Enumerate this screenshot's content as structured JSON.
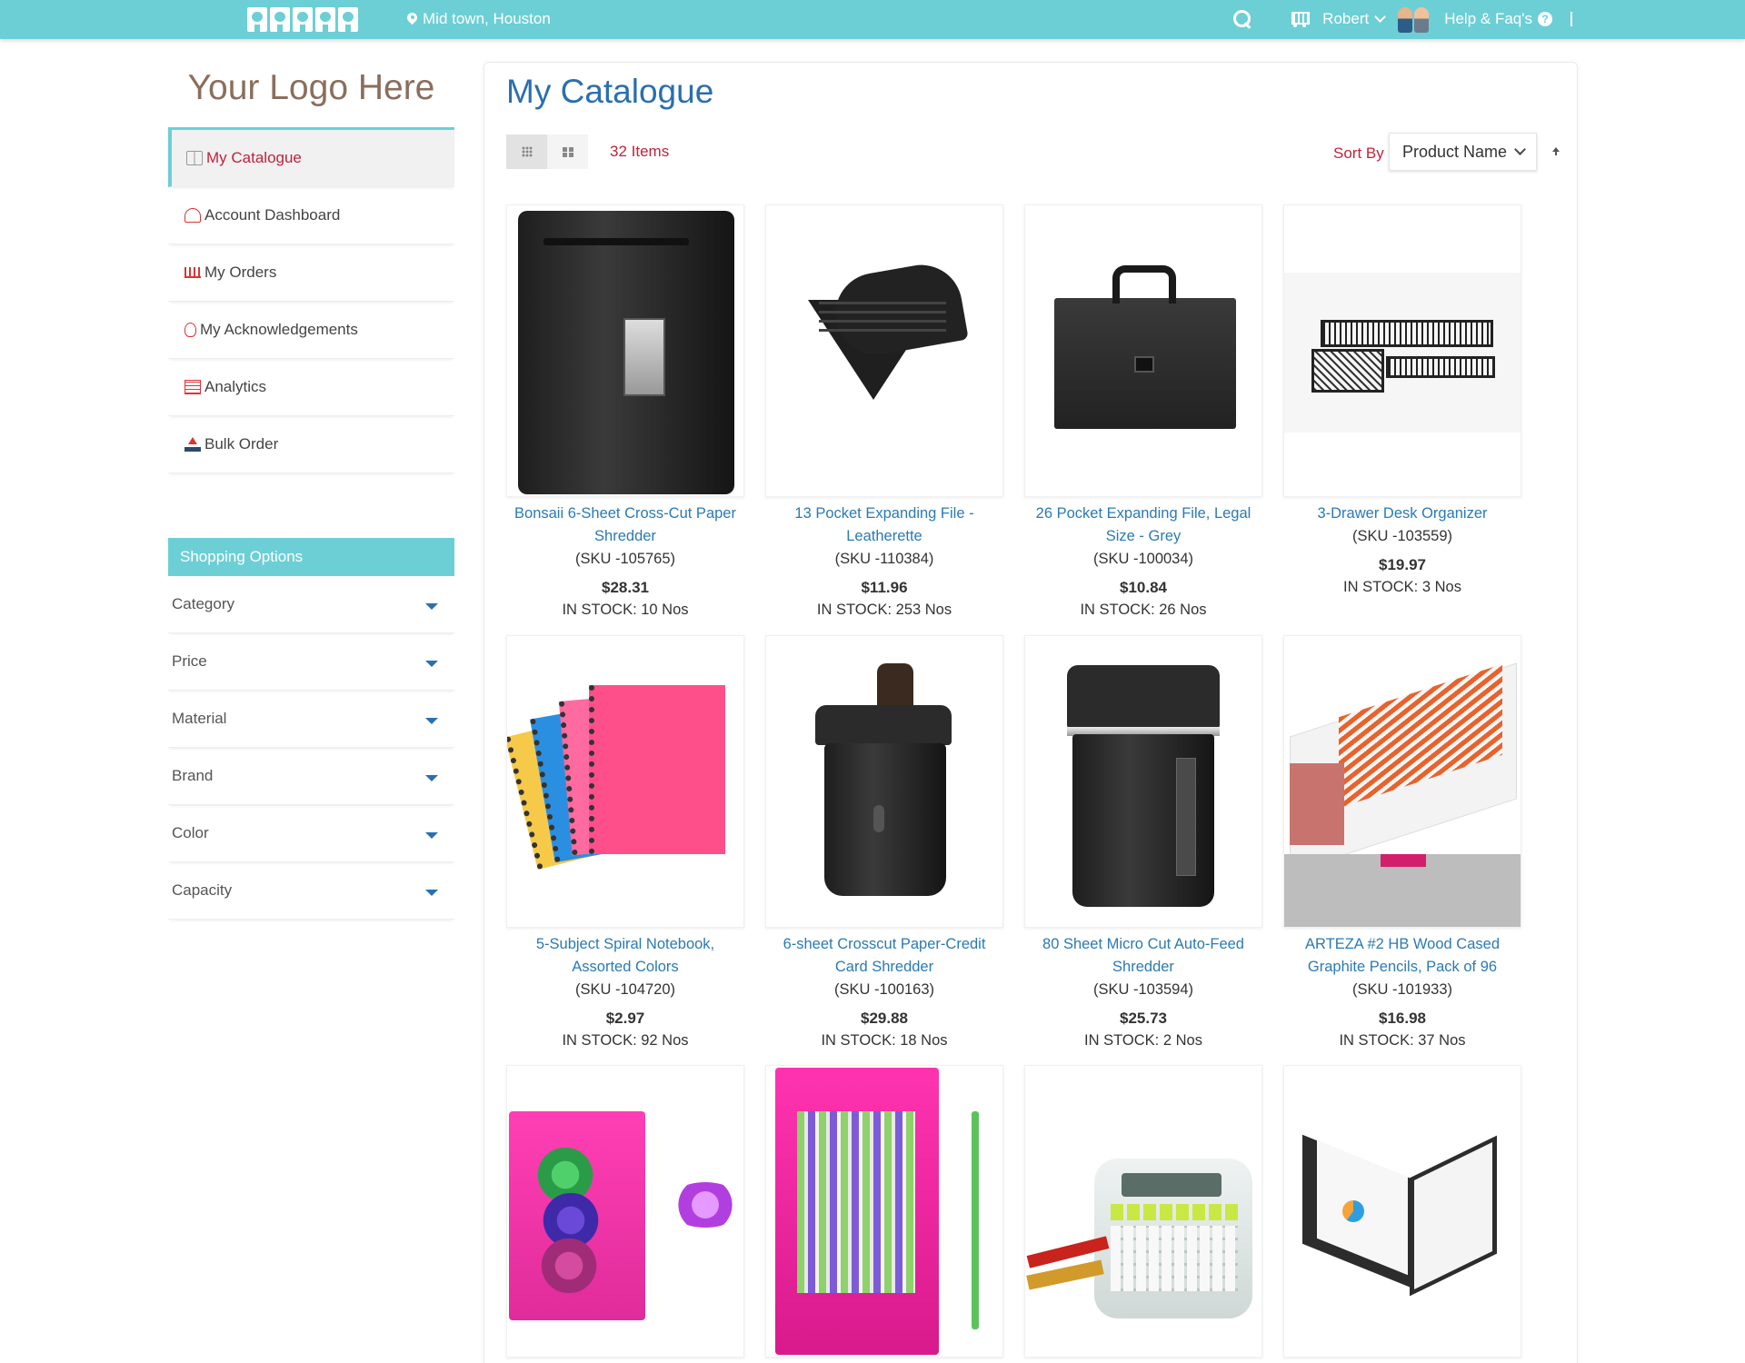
{
  "topbar": {
    "location": "Mid town, Houston",
    "user_name": "Robert",
    "help_label": "Help & Faq's",
    "help_icon_glyph": "?"
  },
  "sidebar": {
    "logo_text": "Your Logo Here",
    "menu": [
      {
        "label": "My Catalogue",
        "icon": "book-icon",
        "active": true
      },
      {
        "label": "Account Dashboard",
        "icon": "dashboard-icon"
      },
      {
        "label": "My Orders",
        "icon": "cart-icon"
      },
      {
        "label": "My Acknowledgements",
        "icon": "acknowledgement-icon"
      },
      {
        "label": "Analytics",
        "icon": "analytics-icon"
      },
      {
        "label": "Bulk Order",
        "icon": "upload-icon"
      }
    ],
    "shopping_options_title": "Shopping Options",
    "filters": [
      "Category",
      "Price",
      "Material",
      "Brand",
      "Color",
      "Capacity"
    ]
  },
  "main": {
    "title": "My Catalogue",
    "items_count": "32 Items",
    "sort_label": "Sort By",
    "sort_value": "Product Name",
    "products": [
      {
        "name": "Bonsaii 6-Sheet Cross-Cut Paper Shredder",
        "sku": "(SKU -105765)",
        "price": "$28.31",
        "stock": "IN STOCK: 10 Nos"
      },
      {
        "name": "13 Pocket Expanding File - Leatherette",
        "sku": "(SKU -110384)",
        "price": "$11.96",
        "stock": "IN STOCK: 253 Nos"
      },
      {
        "name": "26 Pocket Expanding File, Legal Size - Grey",
        "sku": "(SKU -100034)",
        "price": "$10.84",
        "stock": "IN STOCK: 26 Nos"
      },
      {
        "name": "3-Drawer Desk Organizer",
        "sku": "(SKU -103559)",
        "price": "$19.97",
        "stock": "IN STOCK: 3 Nos"
      },
      {
        "name": "5-Subject Spiral Notebook, Assorted Colors",
        "sku": "(SKU -104720)",
        "price": "$2.97",
        "stock": "IN STOCK: 92 Nos"
      },
      {
        "name": "6-sheet Crosscut Paper-Credit Card Shredder",
        "sku": "(SKU -100163)",
        "price": "$29.88",
        "stock": "IN STOCK: 18 Nos"
      },
      {
        "name": "80 Sheet Micro Cut Auto-Feed Shredder",
        "sku": "(SKU -103594)",
        "price": "$25.73",
        "stock": "IN STOCK: 2 Nos"
      },
      {
        "name": "ARTEZA #2 HB Wood Cased Graphite Pencils, Pack of 96",
        "sku": "(SKU -101933)",
        "price": "$16.98",
        "stock": "IN STOCK: 37 Nos"
      }
    ]
  }
}
